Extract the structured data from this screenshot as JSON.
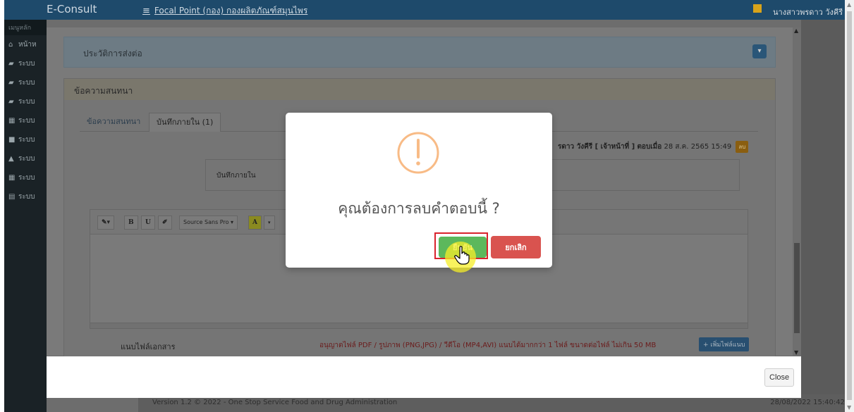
{
  "header": {
    "brand": "E-Consult",
    "menu_icon": "≡",
    "title": "Focal Point (กอง) กองผลิตภัณฑ์สมุนไพร",
    "user": "นางสาวพรดาว วังคีรี"
  },
  "sidebar": {
    "header": "เมนูหลัก",
    "items": [
      {
        "icon": "home-icon",
        "label": "หน้าห"
      },
      {
        "icon": "book-icon",
        "label": "ระบบ"
      },
      {
        "icon": "book-icon",
        "label": "ระบบ"
      },
      {
        "icon": "book-icon",
        "label": "ระบบ"
      },
      {
        "icon": "calendar-icon",
        "label": "ระบบ"
      },
      {
        "icon": "video-icon",
        "label": "ระบบ"
      },
      {
        "icon": "graduation-icon",
        "label": "ระบบ"
      },
      {
        "icon": "calendar-icon",
        "label": "ระบบ"
      },
      {
        "icon": "file-icon",
        "label": "ระบบ"
      }
    ]
  },
  "history_panel": {
    "title": "ประวัติการส่งต่อ"
  },
  "conversation_panel": {
    "title": "ข้อความสนทนา",
    "tabs": [
      {
        "label": "ข้อความสนทนา",
        "active": false
      },
      {
        "label": "บันทึกภายใน (1)",
        "active": true
      }
    ],
    "note_author": "รดาว วังคีรี [ เจ้าหน้าที่ ]",
    "note_meta_label": "ตอบเมื่อ",
    "note_meta_time": "28 ส.ค. 2565 15:49",
    "delete_badge": "ลบ",
    "note_text": "บันทึกภายใน",
    "editor_toolbar": {
      "magic": "✎▾",
      "bold": "B",
      "underline": "U",
      "eraser": "✐",
      "font": "Source Sans Pro ▾",
      "color": "A",
      "color_caret": "▾"
    },
    "attach_label": "แนบไฟล์เอกสาร",
    "attach_note": "อนุญาตไฟล์ PDF / รูปภาพ (PNG,JPG) / วีดีโอ (MP4,AVI) แนบได้มากกว่า 1 ไฟล์ ขนาดต่อไฟล์ ไม่เกิน 50 MB",
    "attach_button": "+ เพิ่มไฟล์แนบ"
  },
  "modal_footer": {
    "close": "Close"
  },
  "alert": {
    "title": "คุณต้องการลบคำตอบนี้ ?",
    "confirm": "ยืนยัน",
    "cancel": "ยกเลิก",
    "icon": "warning-icon",
    "icon_color": "#f8bb86"
  },
  "footer": {
    "version": "Version 1.2 © 2022 - One Stop Service Food and Drug Administration",
    "datetime": "28/08/2022 15:40:42"
  },
  "colors": {
    "confirm": "#5cb85c",
    "cancel": "#d9534f",
    "highlight_frame": "#d9232d",
    "cursor_highlight": "#f5ee28"
  }
}
